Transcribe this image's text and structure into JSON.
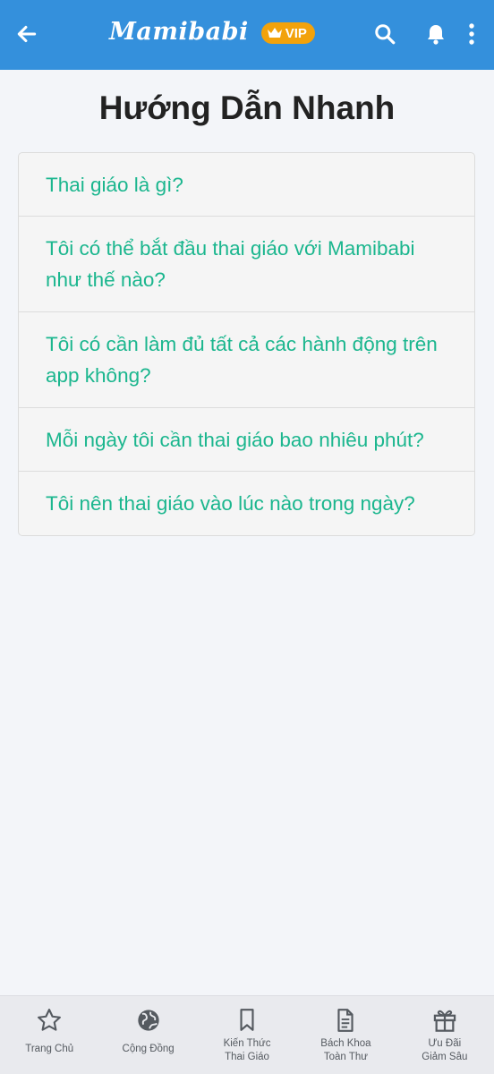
{
  "header": {
    "logo": "Mamibabi",
    "vip_badge": "VIP",
    "colors": {
      "background": "#3490dc",
      "vip": "#f2a20b"
    },
    "icons": [
      "back-arrow-icon",
      "crown-icon",
      "search-icon",
      "bell-icon",
      "more-vertical-icon"
    ]
  },
  "page": {
    "title": "Hướng Dẫn Nhanh"
  },
  "faq": {
    "color": "#1bb68e",
    "items": [
      {
        "label": "Thai giáo là gì?"
      },
      {
        "label": "Tôi có thể bắt đầu thai giáo với Mamibabi như thế nào?"
      },
      {
        "label": "Tôi có cần làm đủ tất cả các hành động trên app không?"
      },
      {
        "label": "Mỗi ngày tôi cần thai giáo bao nhiêu phút?"
      },
      {
        "label": "Tôi nên thai giáo vào lúc nào trong ngày?"
      }
    ]
  },
  "tabbar": {
    "items": [
      {
        "label": "Trang Chủ",
        "icon": "star-icon"
      },
      {
        "label": "Cộng Đồng",
        "icon": "globe-icon"
      },
      {
        "label": "Kiến Thức\nThai Giáo",
        "icon": "bookmark-icon"
      },
      {
        "label": "Bách Khoa\nToàn Thư",
        "icon": "document-icon"
      },
      {
        "label": "Ưu Đãi\nGiảm Sâu",
        "icon": "gift-icon"
      }
    ]
  }
}
